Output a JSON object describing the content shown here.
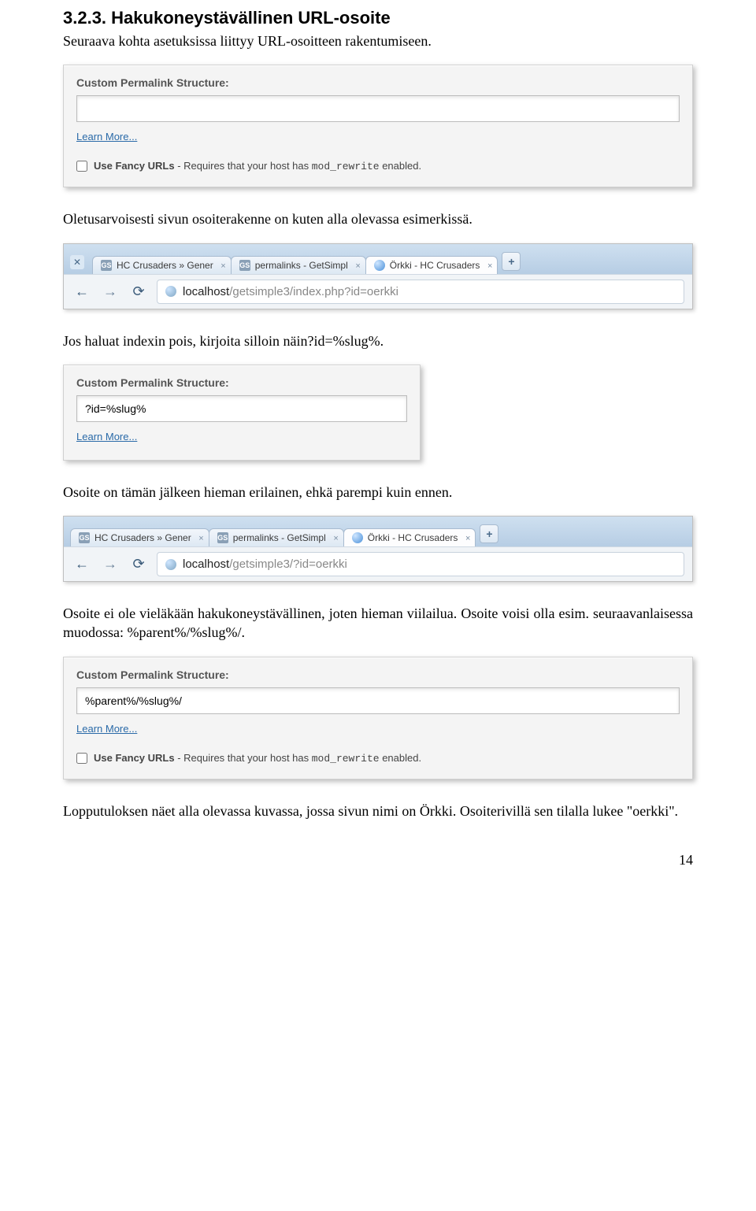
{
  "heading": "3.2.3. Hakukoneystävällinen URL-osoite",
  "intro": "Seuraava kohta asetuksissa liittyy URL-osoitteen rakentumiseen.",
  "panel1": {
    "label": "Custom Permalink Structure:",
    "value": "",
    "learn_more": "Learn More...",
    "fancy_bold": "Use Fancy URLs",
    "fancy_rest": " - Requires that your host has ",
    "fancy_code": "mod_rewrite",
    "fancy_after": " enabled."
  },
  "para_after_panel1": "Oletusarvoisesti sivun osoiterakenne on kuten alla olevassa esimerkissä.",
  "browser1": {
    "tabs": [
      {
        "icon": "GS",
        "label": "HC Crusaders » Gener"
      },
      {
        "icon": "GS",
        "label": "permalinks - GetSimpl"
      },
      {
        "icon": "globe",
        "label": "Örkki - HC Crusaders",
        "active": true
      }
    ],
    "url_host": "localhost",
    "url_path": "/getsimple3/index.php?id=oerkki"
  },
  "para_after_browser1": "Jos haluat indexin pois, kirjoita silloin näin?id=%slug%.",
  "panel2": {
    "label": "Custom Permalink Structure:",
    "value": "?id=%slug%",
    "learn_more": "Learn More..."
  },
  "para_after_panel2": "Osoite on tämän jälkeen hieman erilainen, ehkä parempi kuin ennen.",
  "browser2": {
    "tabs": [
      {
        "icon": "GS",
        "label": "HC Crusaders » Gener"
      },
      {
        "icon": "GS",
        "label": "permalinks - GetSimpl"
      },
      {
        "icon": "globe",
        "label": "Örkki - HC Crusaders",
        "active": true
      }
    ],
    "url_host": "localhost",
    "url_path": "/getsimple3/?id=oerkki"
  },
  "para_after_browser2_a": "Osoite ei ole vieläkään hakukoneystävällinen, joten hieman viilailua. Osoite voisi olla esim. seuraavanlaisessa muodossa: %parent%/%slug%/.",
  "panel3": {
    "label": "Custom Permalink Structure:",
    "value": "%parent%/%slug%/",
    "learn_more": "Learn More...",
    "fancy_bold": "Use Fancy URLs",
    "fancy_rest": " - Requires that your host has ",
    "fancy_code": "mod_rewrite",
    "fancy_after": " enabled."
  },
  "final_para": "Lopputuloksen näet alla olevassa kuvassa, jossa sivun nimi on Örkki. Osoiterivillä sen tilalla lukee \"oerkki\".",
  "page_number": "14"
}
